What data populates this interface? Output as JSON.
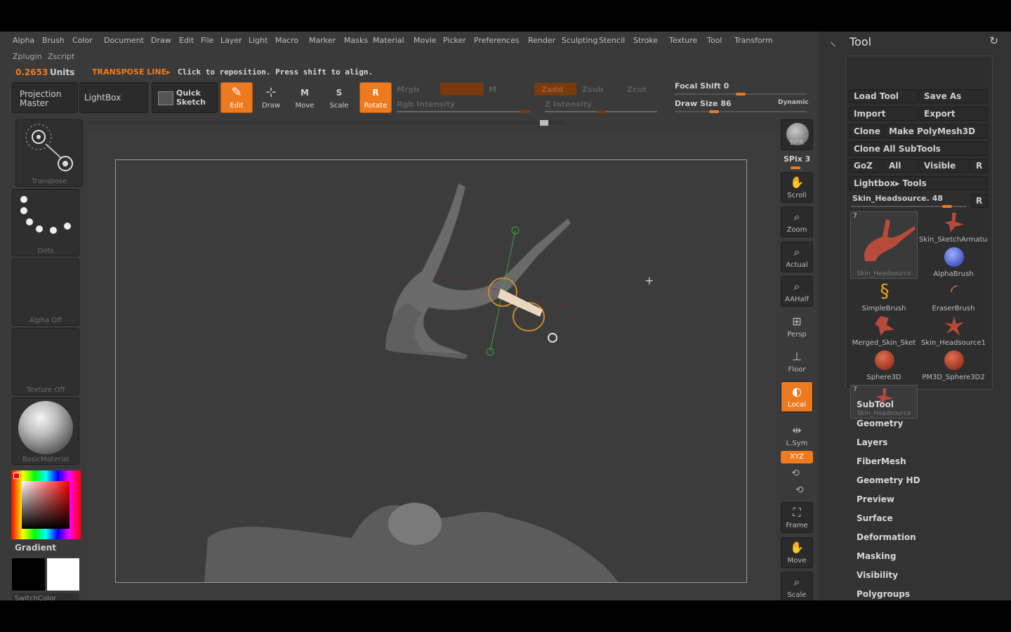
{
  "menu": [
    "Alpha",
    "Brush",
    "Color",
    "Document",
    "Draw",
    "Edit",
    "File",
    "Layer",
    "Light",
    "Macro",
    "Marker",
    "Masks",
    "Material",
    "Movie",
    "Picker",
    "Preferences",
    "Render",
    "Sculpting",
    "Stencil",
    "Stroke",
    "Texture",
    "Tool",
    "Transform"
  ],
  "menu2": [
    "Zplugin",
    "Zscript"
  ],
  "status": {
    "units_value": "0.2653",
    "units_label": "Units",
    "mode": "TRANSPOSE LINE▸",
    "hint": "Click to reposition. Press shift to align."
  },
  "toolbar": {
    "projection_master": "Projection Master",
    "lightbox": "LightBox",
    "quick_sketch": "Quick Sketch",
    "edit": "Edit",
    "draw": "Draw",
    "move": "Move",
    "scale": "Scale",
    "rotate": "Rotate",
    "mrgb": "Mrgb",
    "rgb": "Rgb",
    "m": "M",
    "rgb_intensity": "Rgb Intensity",
    "zadd": "Zadd",
    "zsub": "Zsub",
    "zcut": "Zcut",
    "z_intensity": "Z Intensity",
    "focal_shift": "Focal Shift 0",
    "draw_size": "Draw Size 86",
    "dynamic": "Dynamic",
    "focal_shift_level": 0.1,
    "draw_size_level": 0.08
  },
  "left_tray": {
    "transpose": "Transpose",
    "dots": "Dots",
    "alpha": "Alpha Off",
    "texture": "Texture Off",
    "material": "BasicMaterial",
    "gradient": "Gradient",
    "switchcolor": "SwitchColor",
    "gradient_top": "#ff0000",
    "gradient_bottom": "#000000"
  },
  "right_tray": {
    "bpr": "BPR",
    "spix": "SPix 3",
    "scroll": "Scroll",
    "zoom": "Zoom",
    "actual": "Actual",
    "aahalf": "AAHalf",
    "persp": "Persp",
    "floor": "Floor",
    "local": "Local",
    "lsym": "L.Sym",
    "xyz": "XYZ",
    "frame": "Frame",
    "move": "Move",
    "scale": "Scale"
  },
  "tool_panel": {
    "title": "Tool",
    "load_tool": "Load Tool",
    "save_as": "Save As",
    "import": "Import",
    "export": "Export",
    "clone": "Clone",
    "make_polymesh": "Make PolyMesh3D",
    "clone_all": "Clone All SubTools",
    "goz": "GoZ",
    "all": "All",
    "visible": "Visible",
    "r": "R",
    "lightbox_tools": "Lightbox▸ Tools",
    "current_tool": "Skin_Headsource. 48",
    "thumbs": [
      {
        "name": "Skin_Headsource",
        "badge": "7"
      },
      {
        "name": "Skin_SketchArmature"
      },
      {
        "name": "AlphaBrush"
      },
      {
        "name": "SimpleBrush"
      },
      {
        "name": "EraserBrush"
      },
      {
        "name": "Merged_Skin_Sket"
      },
      {
        "name": "Skin_Headsource1"
      },
      {
        "name": "Sphere3D"
      },
      {
        "name": "PM3D_Sphere3D2"
      },
      {
        "name": "Skin_Headsource",
        "badge": "7"
      }
    ],
    "sections": [
      "SubTool",
      "Geometry",
      "Layers",
      "FiberMesh",
      "Geometry HD",
      "Preview",
      "Surface",
      "Deformation",
      "Masking",
      "Visibility",
      "Polygroups"
    ]
  },
  "colors": {
    "accent": "#ee7a1f",
    "panel": "#333333",
    "canvas": "#3c3c3c"
  }
}
